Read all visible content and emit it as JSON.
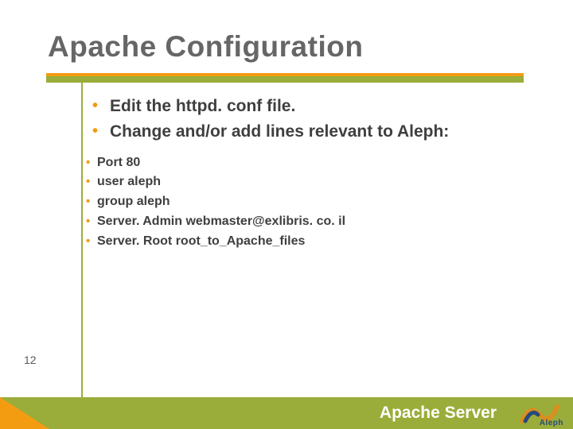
{
  "title": "Apache Configuration",
  "page_number": "12",
  "big_bullets": [
    "Edit the httpd. conf file.",
    "Change and/or add lines relevant to Aleph:"
  ],
  "small_bullets": [
    "Port 80",
    "user aleph",
    "group aleph",
    "Server. Admin webmaster@exlibris. co. il",
    "Server. Root root_to_Apache_files"
  ],
  "footer_text": "Apache Server",
  "logo_text": "Aleph",
  "colors": {
    "orange": "#f39c12",
    "olive": "#9aad3a",
    "title_gray": "#666666",
    "body_text": "#3f3f3f"
  }
}
